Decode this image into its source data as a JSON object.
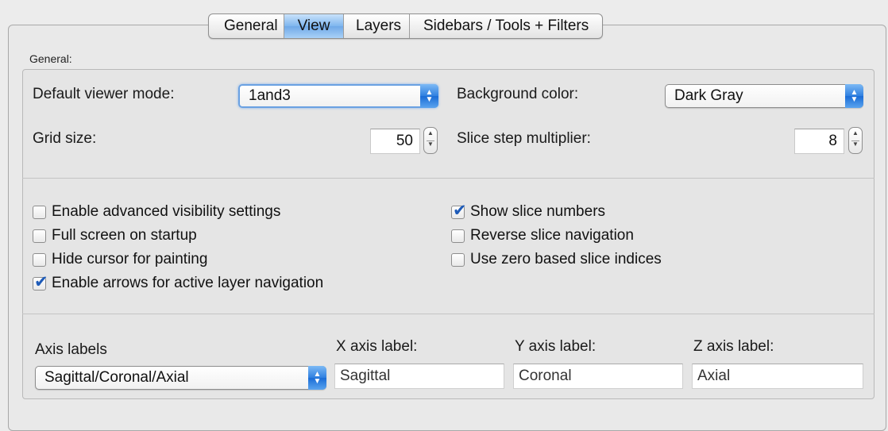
{
  "tabs": [
    {
      "label": "General",
      "active": false
    },
    {
      "label": "View",
      "active": true
    },
    {
      "label": "Layers",
      "active": false
    },
    {
      "label": "Sidebars / Tools + Filters",
      "active": false
    }
  ],
  "general": {
    "title": "General:",
    "default_viewer_mode": {
      "label": "Default viewer mode:",
      "value": "1and3"
    },
    "background_color": {
      "label": "Background color:",
      "value": "Dark Gray"
    },
    "grid_size": {
      "label": "Grid size:",
      "value": "50"
    },
    "slice_step_multiplier": {
      "label": "Slice step multiplier:",
      "value": "8"
    }
  },
  "checkboxes": {
    "advanced_visibility": {
      "label": "Enable advanced visibility settings",
      "checked": false
    },
    "full_screen": {
      "label": "Full screen on startup",
      "checked": false
    },
    "hide_cursor": {
      "label": "Hide cursor for painting",
      "checked": false
    },
    "enable_arrows": {
      "label": "Enable arrows for active layer navigation",
      "checked": true
    },
    "show_slice_numbers": {
      "label": "Show slice numbers",
      "checked": true
    },
    "reverse_slice_nav": {
      "label": "Reverse slice navigation",
      "checked": false
    },
    "zero_based": {
      "label": "Use zero based slice indices",
      "checked": false
    }
  },
  "axis": {
    "label": "Axis labels",
    "preset": "Sagittal/Coronal/Axial",
    "x_label": "X axis label:",
    "x_value": "Sagittal",
    "y_label": "Y axis label:",
    "y_value": "Coronal",
    "z_label": "Z axis label:",
    "z_value": "Axial"
  },
  "colors": {
    "accent": "#2f7fe0",
    "tab_active": "#7fb6ee"
  }
}
